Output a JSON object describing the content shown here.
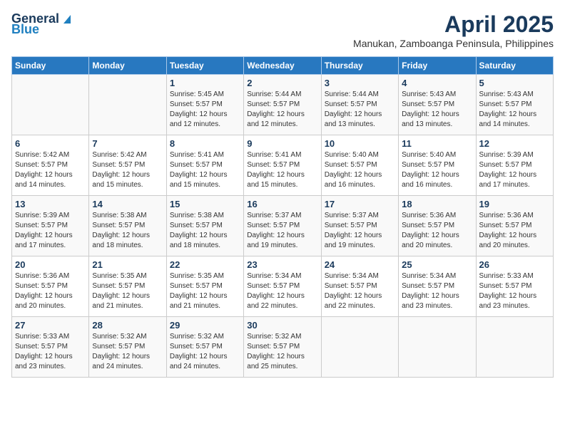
{
  "header": {
    "logo_general": "General",
    "logo_blue": "Blue",
    "title": "April 2025",
    "subtitle": "Manukan, Zamboanga Peninsula, Philippines"
  },
  "days_of_week": [
    "Sunday",
    "Monday",
    "Tuesday",
    "Wednesday",
    "Thursday",
    "Friday",
    "Saturday"
  ],
  "weeks": [
    [
      {
        "day": "",
        "info": ""
      },
      {
        "day": "",
        "info": ""
      },
      {
        "day": "1",
        "info": "Sunrise: 5:45 AM\nSunset: 5:57 PM\nDaylight: 12 hours\nand 12 minutes."
      },
      {
        "day": "2",
        "info": "Sunrise: 5:44 AM\nSunset: 5:57 PM\nDaylight: 12 hours\nand 12 minutes."
      },
      {
        "day": "3",
        "info": "Sunrise: 5:44 AM\nSunset: 5:57 PM\nDaylight: 12 hours\nand 13 minutes."
      },
      {
        "day": "4",
        "info": "Sunrise: 5:43 AM\nSunset: 5:57 PM\nDaylight: 12 hours\nand 13 minutes."
      },
      {
        "day": "5",
        "info": "Sunrise: 5:43 AM\nSunset: 5:57 PM\nDaylight: 12 hours\nand 14 minutes."
      }
    ],
    [
      {
        "day": "6",
        "info": "Sunrise: 5:42 AM\nSunset: 5:57 PM\nDaylight: 12 hours\nand 14 minutes."
      },
      {
        "day": "7",
        "info": "Sunrise: 5:42 AM\nSunset: 5:57 PM\nDaylight: 12 hours\nand 15 minutes."
      },
      {
        "day": "8",
        "info": "Sunrise: 5:41 AM\nSunset: 5:57 PM\nDaylight: 12 hours\nand 15 minutes."
      },
      {
        "day": "9",
        "info": "Sunrise: 5:41 AM\nSunset: 5:57 PM\nDaylight: 12 hours\nand 15 minutes."
      },
      {
        "day": "10",
        "info": "Sunrise: 5:40 AM\nSunset: 5:57 PM\nDaylight: 12 hours\nand 16 minutes."
      },
      {
        "day": "11",
        "info": "Sunrise: 5:40 AM\nSunset: 5:57 PM\nDaylight: 12 hours\nand 16 minutes."
      },
      {
        "day": "12",
        "info": "Sunrise: 5:39 AM\nSunset: 5:57 PM\nDaylight: 12 hours\nand 17 minutes."
      }
    ],
    [
      {
        "day": "13",
        "info": "Sunrise: 5:39 AM\nSunset: 5:57 PM\nDaylight: 12 hours\nand 17 minutes."
      },
      {
        "day": "14",
        "info": "Sunrise: 5:38 AM\nSunset: 5:57 PM\nDaylight: 12 hours\nand 18 minutes."
      },
      {
        "day": "15",
        "info": "Sunrise: 5:38 AM\nSunset: 5:57 PM\nDaylight: 12 hours\nand 18 minutes."
      },
      {
        "day": "16",
        "info": "Sunrise: 5:37 AM\nSunset: 5:57 PM\nDaylight: 12 hours\nand 19 minutes."
      },
      {
        "day": "17",
        "info": "Sunrise: 5:37 AM\nSunset: 5:57 PM\nDaylight: 12 hours\nand 19 minutes."
      },
      {
        "day": "18",
        "info": "Sunrise: 5:36 AM\nSunset: 5:57 PM\nDaylight: 12 hours\nand 20 minutes."
      },
      {
        "day": "19",
        "info": "Sunrise: 5:36 AM\nSunset: 5:57 PM\nDaylight: 12 hours\nand 20 minutes."
      }
    ],
    [
      {
        "day": "20",
        "info": "Sunrise: 5:36 AM\nSunset: 5:57 PM\nDaylight: 12 hours\nand 20 minutes."
      },
      {
        "day": "21",
        "info": "Sunrise: 5:35 AM\nSunset: 5:57 PM\nDaylight: 12 hours\nand 21 minutes."
      },
      {
        "day": "22",
        "info": "Sunrise: 5:35 AM\nSunset: 5:57 PM\nDaylight: 12 hours\nand 21 minutes."
      },
      {
        "day": "23",
        "info": "Sunrise: 5:34 AM\nSunset: 5:57 PM\nDaylight: 12 hours\nand 22 minutes."
      },
      {
        "day": "24",
        "info": "Sunrise: 5:34 AM\nSunset: 5:57 PM\nDaylight: 12 hours\nand 22 minutes."
      },
      {
        "day": "25",
        "info": "Sunrise: 5:34 AM\nSunset: 5:57 PM\nDaylight: 12 hours\nand 23 minutes."
      },
      {
        "day": "26",
        "info": "Sunrise: 5:33 AM\nSunset: 5:57 PM\nDaylight: 12 hours\nand 23 minutes."
      }
    ],
    [
      {
        "day": "27",
        "info": "Sunrise: 5:33 AM\nSunset: 5:57 PM\nDaylight: 12 hours\nand 23 minutes."
      },
      {
        "day": "28",
        "info": "Sunrise: 5:32 AM\nSunset: 5:57 PM\nDaylight: 12 hours\nand 24 minutes."
      },
      {
        "day": "29",
        "info": "Sunrise: 5:32 AM\nSunset: 5:57 PM\nDaylight: 12 hours\nand 24 minutes."
      },
      {
        "day": "30",
        "info": "Sunrise: 5:32 AM\nSunset: 5:57 PM\nDaylight: 12 hours\nand 25 minutes."
      },
      {
        "day": "",
        "info": ""
      },
      {
        "day": "",
        "info": ""
      },
      {
        "day": "",
        "info": ""
      }
    ]
  ]
}
